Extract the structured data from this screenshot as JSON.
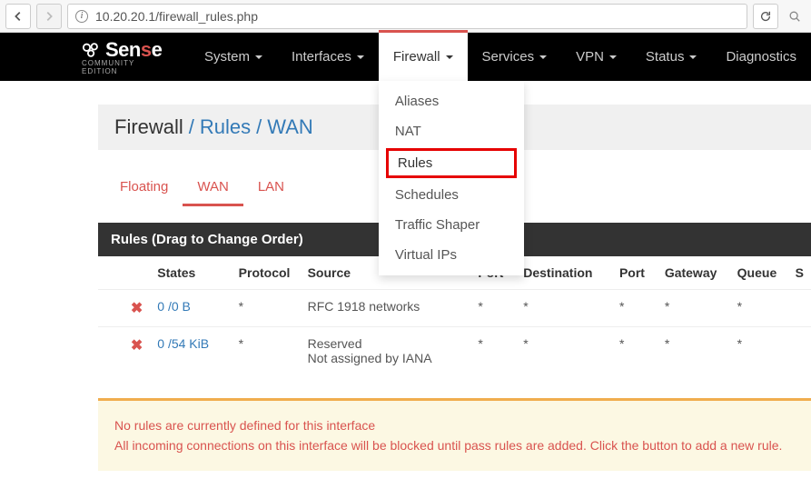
{
  "browser": {
    "url": "10.20.20.1/firewall_rules.php"
  },
  "logo": {
    "text_pre": "Sen",
    "text_s": "s",
    "text_post": "e",
    "sub": "COMMUNITY EDITION"
  },
  "nav": {
    "items": [
      {
        "label": "System"
      },
      {
        "label": "Interfaces"
      },
      {
        "label": "Firewall",
        "active": true
      },
      {
        "label": "Services"
      },
      {
        "label": "VPN"
      },
      {
        "label": "Status"
      },
      {
        "label": "Diagnostics"
      }
    ]
  },
  "dropdown": {
    "items": [
      {
        "label": "Aliases"
      },
      {
        "label": "NAT"
      },
      {
        "label": "Rules",
        "highlighted": true
      },
      {
        "label": "Schedules"
      },
      {
        "label": "Traffic Shaper"
      },
      {
        "label": "Virtual IPs"
      }
    ]
  },
  "breadcrumb": {
    "root": "Firewall",
    "l1": "Rules",
    "l2": "WAN",
    "sep": "/"
  },
  "tabs": {
    "items": [
      {
        "label": "Floating"
      },
      {
        "label": "WAN",
        "active": true
      },
      {
        "label": "LAN"
      }
    ]
  },
  "panel": {
    "title": "Rules (Drag to Change Order)"
  },
  "table": {
    "headers": [
      "",
      "",
      "States",
      "Protocol",
      "Source",
      "Port",
      "Destination",
      "Port",
      "Gateway",
      "Queue",
      "S"
    ],
    "rows": [
      {
        "icon": "✖",
        "states": "0 /0 B",
        "protocol": "*",
        "source": "RFC 1918 networks",
        "sport": "*",
        "dest": "*",
        "dport": "*",
        "gateway": "*",
        "queue": "*"
      },
      {
        "icon": "✖",
        "states": "0 /54 KiB",
        "protocol": "*",
        "source": "Reserved",
        "source_l2": "Not assigned by IANA",
        "sport": "*",
        "dest": "*",
        "dport": "*",
        "gateway": "*",
        "queue": "*"
      }
    ]
  },
  "alert": {
    "line1": "No rules are currently defined for this interface",
    "line2": "All incoming connections on this interface will be blocked until pass rules are added. Click the button to add a new rule."
  }
}
